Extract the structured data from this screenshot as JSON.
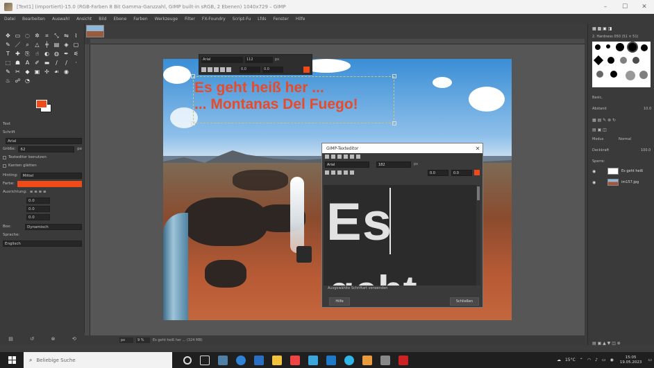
{
  "window": {
    "title": "[Text1] (importiert)-15.0 (RGB-Farben 8 Bit Gamma-Ganzzahl, GIMP built-in sRGB, 2 Ebenen) 1040x729 – GIMP",
    "controls": [
      "–",
      "☐",
      "✕"
    ]
  },
  "menu": [
    "Datei",
    "Bearbeiten",
    "Auswahl",
    "Ansicht",
    "Bild",
    "Ebene",
    "Farben",
    "Werkzeuge",
    "Filter",
    "FX-Foundry",
    "Script-Fu",
    "Lfds",
    "Fenster",
    "Hilfe"
  ],
  "tool_options": {
    "section": "Text",
    "font_label": "Schrift",
    "font_value": "Arial",
    "size_label": "Größe:",
    "size_value": "62",
    "size_unit": "px",
    "check1": "Texteditor benutzen",
    "check2": "Kanten glätten",
    "hinting_label": "Hinting:",
    "hinting_value": "Mittel",
    "color_label": "Farbe:",
    "justify_label": "Ausrichtung:",
    "indent_value": "0.0",
    "line_spacing": "0.0",
    "letter_spacing": "0.0",
    "box_label": "Box:",
    "box_value": "Dynamisch",
    "language_label": "Sprache:",
    "language_value": "Englisch"
  },
  "canvas_text": {
    "line1": "Es geht heiß her ...",
    "line2": "... Montanas Del Fuego!"
  },
  "floating_bar": {
    "font": "Arial",
    "size": "112",
    "unit": "px",
    "baseline": "0.0",
    "kerning": "0.0"
  },
  "dialog": {
    "title": "GIMP-Texteditor",
    "font": "Arial",
    "size": "182",
    "unit": "px",
    "val1": "0.0",
    "val2": "0.0",
    "editor_line1": "Es",
    "editor_line2": "geht",
    "checkbox": "Ausgewählte Schriftart verwenden",
    "help_button": "Hilfe",
    "close_button": "Schließen"
  },
  "status": {
    "unit": "px",
    "zoom": "9 %",
    "message": "Es geht heiß her ... (324 MB)"
  },
  "dock": {
    "brush_name": "2. Hardness 050 (51 × 51)",
    "brush_preset": "Basic,",
    "spacing_label": "Abstand",
    "spacing_value": "10.0",
    "mode_label": "Modus",
    "mode_value": "Normal",
    "opacity_label": "Deckkraft",
    "opacity_value": "100.0",
    "lock_label": "Sperre:",
    "layers": [
      {
        "name": "Es geht heiß"
      },
      {
        "name": "im157.jpg"
      }
    ]
  },
  "taskbar": {
    "search_placeholder": "Beliebige Suche",
    "temperature": "15°C",
    "time": "15:05",
    "date": "19.05.2023"
  },
  "colors": {
    "fg": "#f04a18",
    "bg": "#ffffff",
    "text": "#e84a2a"
  }
}
